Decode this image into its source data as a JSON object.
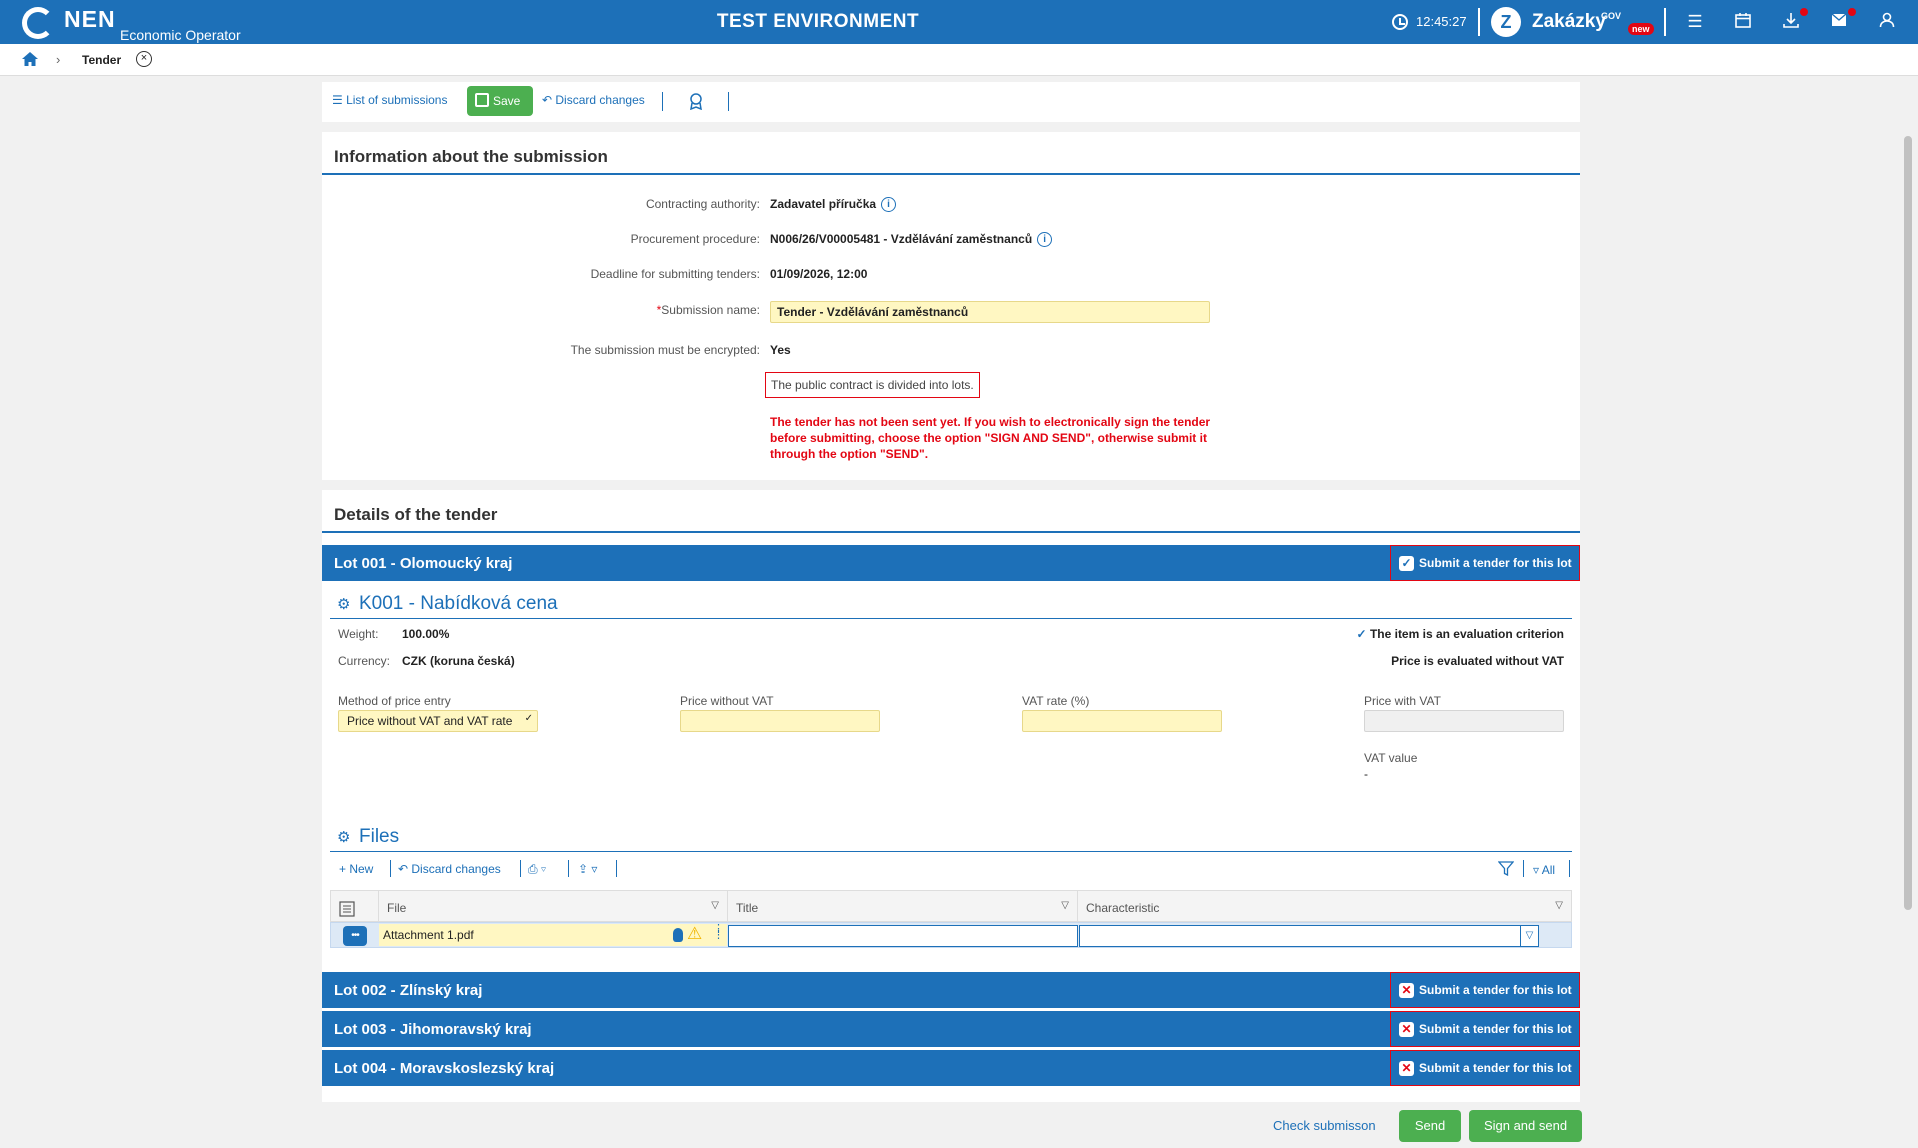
{
  "header": {
    "logo_text": "NEN",
    "logo_subtitle": "Economic Operator",
    "environment_title": "TEST ENVIRONMENT",
    "clock": "12:45:27",
    "zakazky_letter": "Z",
    "zakazky_label": "Zakázky",
    "zakazky_gov": "GOV",
    "zakazky_new": "new",
    "accent": "#1d70b8"
  },
  "breadcrumb": {
    "title": "Tender"
  },
  "toolbar": {
    "list_label": "List of submissions",
    "save_label": "Save",
    "discard_label": "Discard changes"
  },
  "info": {
    "title": "Information about the submission",
    "contracting_authority_label": "Contracting authority:",
    "contracting_authority": "Zadavatel příručka",
    "procedure_label": "Procurement procedure:",
    "procedure": "N006/26/V00005481 - Vzdělávání zaměstnanců",
    "deadline_label": "Deadline for submitting tenders:",
    "deadline": "01/09/2026, 12:00",
    "submission_name_label": "Submission name:",
    "submission_name": "Tender - Vzdělávání zaměstnanců",
    "encrypted_label": "The submission must be encrypted:",
    "encrypted": "Yes",
    "lots_notice": "The public contract is divided into lots.",
    "warning": "The tender has not been sent yet. If you wish to electronically sign the tender before submitting, choose the option \"SIGN AND SEND\", otherwise submit it through the option \"SEND\"."
  },
  "details": {
    "title": "Details of the tender",
    "submit_lot_label": "Submit a tender for this lot",
    "lots": [
      {
        "title": "Lot 001 - Olomoucký kraj",
        "checked": true
      },
      {
        "title": "Lot 002 - Zlínský kraj",
        "checked": false
      },
      {
        "title": "Lot 003 - Jihomoravský kraj",
        "checked": false
      },
      {
        "title": "Lot 004 - Moravskoslezský kraj",
        "checked": false
      }
    ]
  },
  "criterion": {
    "title": "K001 - Nabídková cena",
    "weight_label": "Weight:",
    "weight": "100.00%",
    "currency_label": "Currency:",
    "currency": "CZK (koruna česká)",
    "eval_criterion": "The item is an evaluation criterion",
    "eval_without_vat": "Price is evaluated without VAT",
    "method_label": "Method of price entry",
    "method_value": "Price without VAT and VAT rate",
    "price_without_vat_label": "Price without VAT",
    "vat_rate_label": "VAT rate (%)",
    "price_with_vat_label": "Price with VAT",
    "vat_value_label": "VAT value",
    "vat_value": "-"
  },
  "files": {
    "title": "Files",
    "new_label": "New",
    "discard_label": "Discard changes",
    "all_label": "All",
    "columns": [
      "File",
      "Title",
      "Characteristic"
    ],
    "rows": [
      {
        "file": "Attachment 1.pdf",
        "title": "",
        "characteristic": ""
      }
    ]
  },
  "footer": {
    "check_label": "Check submisson",
    "send_label": "Send",
    "sign_send_label": "Sign and send"
  }
}
